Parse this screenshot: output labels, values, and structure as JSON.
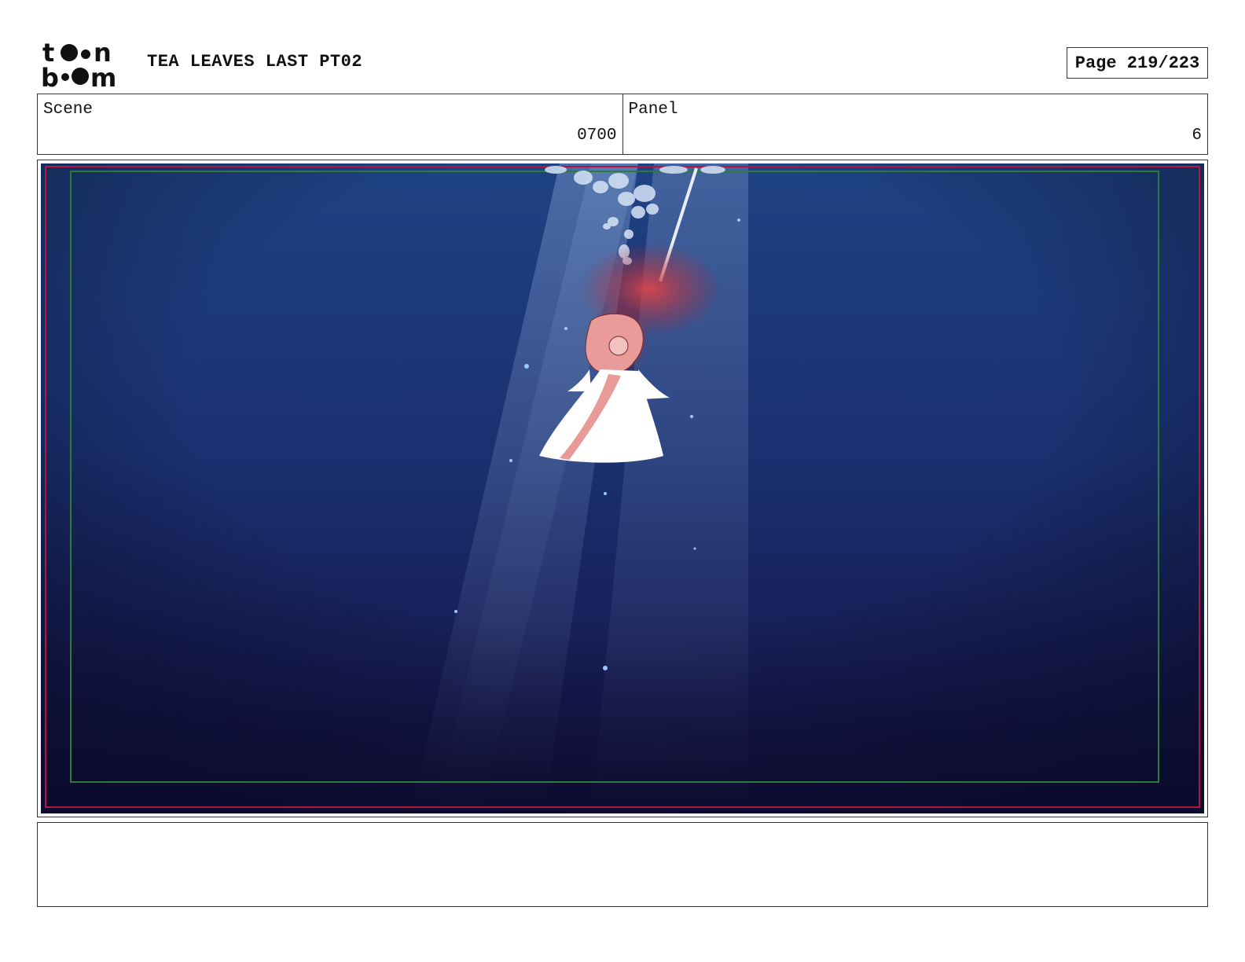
{
  "header": {
    "logo": {
      "name": "toon boom logo",
      "text": "toon boom"
    },
    "project_title": "TEA LEAVES LAST PT02",
    "page_label": "Page 219/223"
  },
  "info": {
    "scene_label": "Scene",
    "scene_value": "0700",
    "panel_label": "Panel",
    "panel_value": "6"
  },
  "panel_image": {
    "description_icon": "underwater-figure-illustration",
    "colors": {
      "water_top": "#1c3d7e",
      "water_bottom": "#120f3e",
      "safe_frame_outer": "#b0173f",
      "safe_frame_inner": "#2e7a3a",
      "figure_dress": "#ffffff",
      "figure_hair": "#c8343a"
    }
  },
  "caption": {
    "text": ""
  }
}
